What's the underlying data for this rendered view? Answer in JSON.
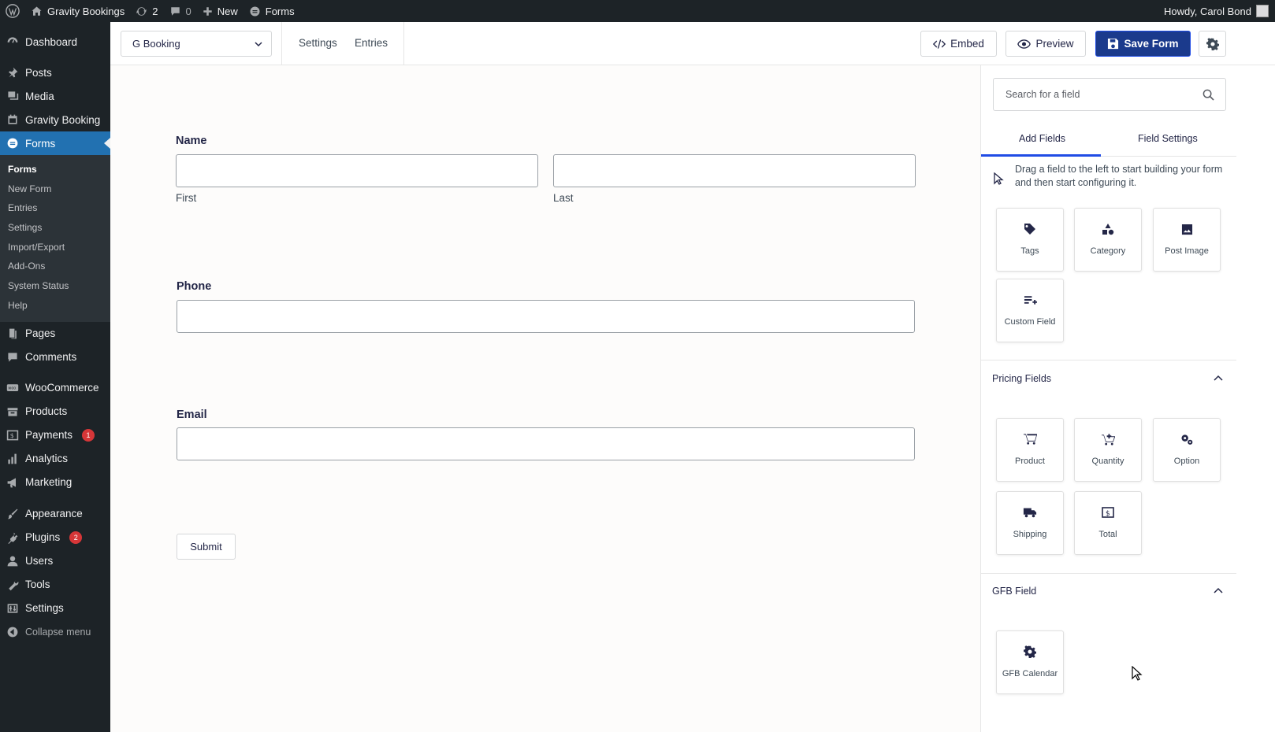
{
  "admin_bar": {
    "site_name": "Gravity Bookings",
    "updates_count": "2",
    "comments_count": "0",
    "new_label": "New",
    "forms_label": "Forms",
    "greeting": "Howdy, Carol Bond"
  },
  "sidebar": {
    "dashboard": "Dashboard",
    "posts": "Posts",
    "media": "Media",
    "gravity_booking": "Gravity Booking",
    "forms": "Forms",
    "forms_submenu": [
      "Forms",
      "New Form",
      "Entries",
      "Settings",
      "Import/Export",
      "Add-Ons",
      "System Status",
      "Help"
    ],
    "pages": "Pages",
    "comments": "Comments",
    "woocommerce": "WooCommerce",
    "products": "Products",
    "payments": "Payments",
    "payments_badge": "1",
    "analytics": "Analytics",
    "marketing": "Marketing",
    "appearance": "Appearance",
    "plugins": "Plugins",
    "plugins_badge": "2",
    "users": "Users",
    "tools": "Tools",
    "settings": "Settings",
    "collapse": "Collapse menu"
  },
  "toolbar": {
    "form_selected": "G Booking",
    "settings_link": "Settings",
    "entries_link": "Entries",
    "embed_label": "Embed",
    "preview_label": "Preview",
    "save_label": "Save Form"
  },
  "form": {
    "name_label": "Name",
    "name_first": "First",
    "name_last": "Last",
    "phone_label": "Phone",
    "email_label": "Email",
    "submit_label": "Submit"
  },
  "panel": {
    "search_placeholder": "Search for a field",
    "tab_add_fields": "Add Fields",
    "tab_field_settings": "Field Settings",
    "hint": "Drag a field to the left to start building your form and then start configuring it.",
    "post_fields": [
      "Tags",
      "Category",
      "Post Image",
      "Custom Field"
    ],
    "pricing_title": "Pricing Fields",
    "pricing_fields": [
      "Product",
      "Quantity",
      "Option",
      "Shipping",
      "Total"
    ],
    "gfb_title": "GFB Field",
    "gfb_fields": [
      "GFB Calendar"
    ]
  },
  "colors": {
    "admin_dark": "#1d2327",
    "active_blue": "#2271b1",
    "save_button": "#1b3a8c",
    "tab_accent": "#204ce5"
  }
}
